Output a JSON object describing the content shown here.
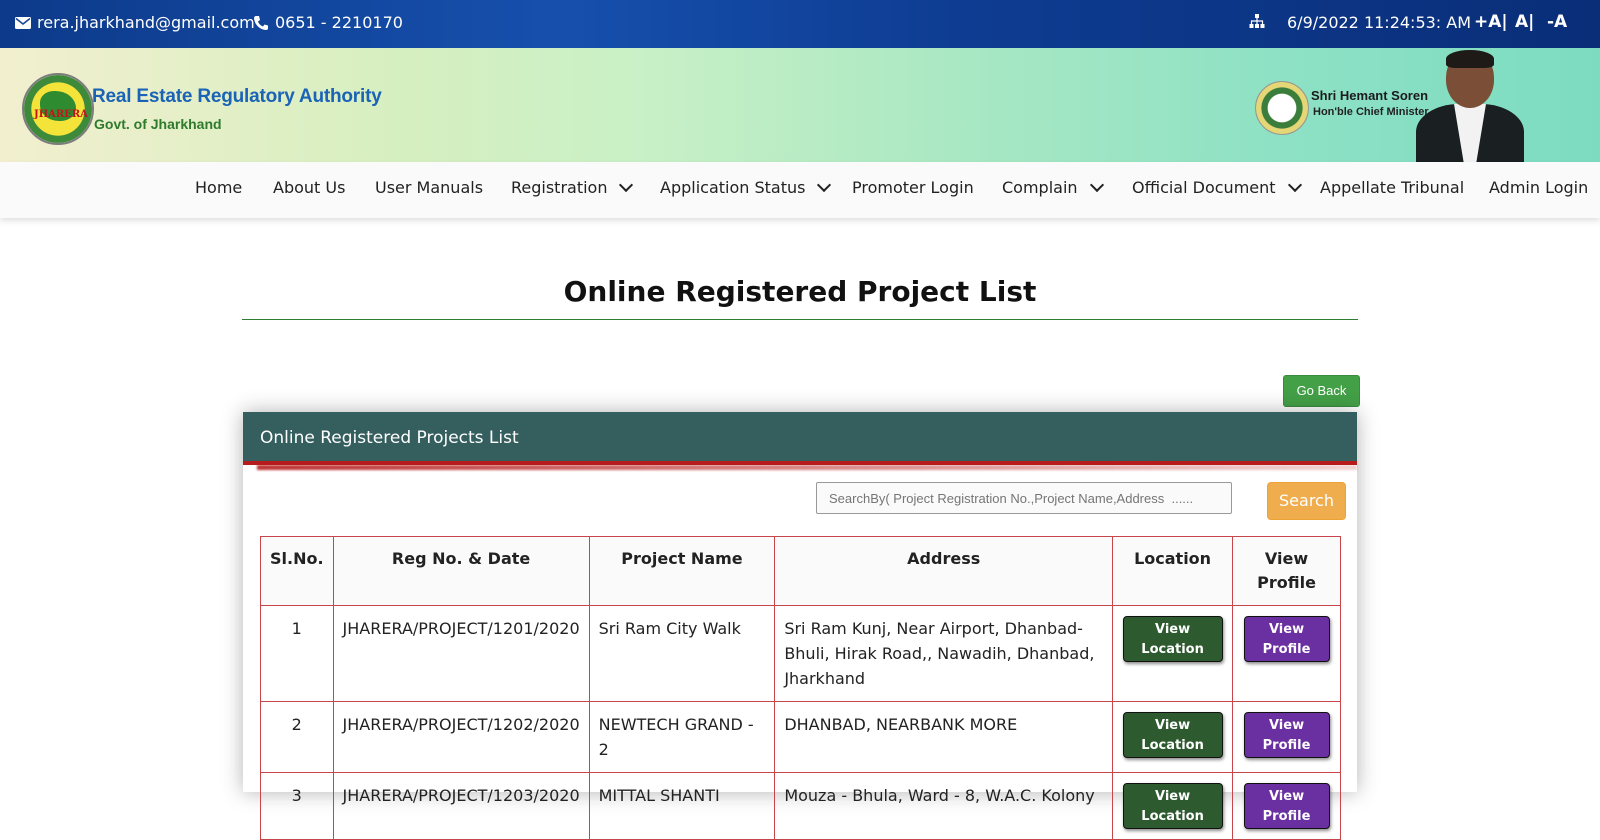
{
  "topbar": {
    "email": "rera.jharkhand@gmail.com",
    "phone": "0651 - 2210170",
    "datetime": "6/9/2022 11:24:53: AM",
    "font_increase": "+A|",
    "font_normal": "A|",
    "font_decrease": "-A"
  },
  "banner": {
    "logo_text": "JHARERA",
    "org_name": "Real Estate Regulatory Authority",
    "org_sub": "Govt. of Jharkhand",
    "cm_name": "Shri Hemant Soren",
    "cm_title": "Hon'ble Chief Minister"
  },
  "nav": {
    "home": "Home",
    "about": "About Us",
    "manuals": "User Manuals",
    "registration": "Registration",
    "application_status": "Application Status",
    "promoter_login": "Promoter Login",
    "complain": "Complain",
    "official_document": "Official Document",
    "appellate": "Appellate Tribunal",
    "admin_login": "Admin Login"
  },
  "page": {
    "title": "Online Registered Project List",
    "go_back": "Go Back",
    "card_title": "Online Registered Projects List",
    "search_placeholder": "SearchBy( Project Registration No.,Project Name,Address  ......",
    "search_button": "Search"
  },
  "table": {
    "headers": [
      "Sl.No.",
      "Reg No. & Date",
      "Project Name",
      "Address",
      "Location",
      "View Profile"
    ],
    "view_location": "View Location",
    "view_profile": "View Profile",
    "rows": [
      {
        "sl": "1",
        "reg": "JHARERA/PROJECT/1201/2020",
        "name": "Sri Ram City Walk",
        "address": "Sri Ram Kunj, Near Airport, Dhanbad-Bhuli, Hirak Road,, Nawadih, Dhanbad, Jharkhand"
      },
      {
        "sl": "2",
        "reg": "JHARERA/PROJECT/1202/2020",
        "name": "NEWTECH GRAND - 2",
        "address": "DHANBAD, NEARBANK MORE"
      },
      {
        "sl": "3",
        "reg": "JHARERA/PROJECT/1203/2020",
        "name": "MITTAL SHANTI",
        "address": "Mouza - Bhula, Ward - 8, W.A.C. Kolony"
      }
    ]
  }
}
